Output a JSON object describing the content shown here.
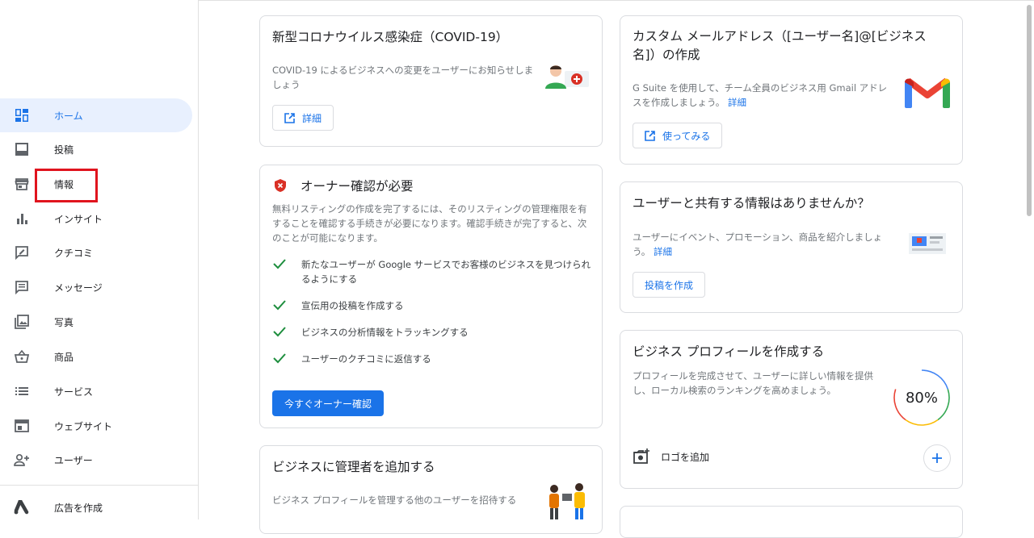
{
  "sidebar": {
    "items": [
      {
        "label": "ホーム",
        "icon": "dashboard-icon"
      },
      {
        "label": "投稿",
        "icon": "post-icon"
      },
      {
        "label": "情報",
        "icon": "store-icon"
      },
      {
        "label": "インサイト",
        "icon": "bar-chart-icon"
      },
      {
        "label": "クチコミ",
        "icon": "review-icon"
      },
      {
        "label": "メッセージ",
        "icon": "message-icon"
      },
      {
        "label": "写真",
        "icon": "photo-icon"
      },
      {
        "label": "商品",
        "icon": "basket-icon"
      },
      {
        "label": "サービス",
        "icon": "list-icon"
      },
      {
        "label": "ウェブサイト",
        "icon": "website-icon"
      },
      {
        "label": "ユーザー",
        "icon": "add-user-icon"
      }
    ],
    "ads": {
      "label": "広告を作成",
      "icon": "google-ads-icon"
    }
  },
  "covid": {
    "title": "新型コロナウイルス感染症（COVID-19）",
    "text": "COVID-19 によるビジネスへの変更をユーザーにお知らせしましょう",
    "button": "詳細"
  },
  "verify": {
    "title": "オーナー確認が必要",
    "text": "無料リスティングの作成を完了するには、そのリスティングの管理権限を有することを確認する手続きが必要になります。確認手続きが完了すると、次のことが可能になります。",
    "checks": [
      "新たなユーザーが Google サービスでお客様のビジネスを見つけられるようにする",
      "宣伝用の投稿を作成する",
      "ビジネスの分析情報をトラッキングする",
      "ユーザーのクチコミに返信する"
    ],
    "button": "今すぐオーナー確認"
  },
  "manager": {
    "title": "ビジネスに管理者を追加する",
    "text": "ビジネス プロフィールを管理する他のユーザーを招待する"
  },
  "email": {
    "title": "カスタム メールアドレス（[ユーザー名]@[ビジネス名]）の作成",
    "text": "G Suite を使用して、チーム全員のビジネス用 Gmail アドレスを作成しましょう。",
    "link": "詳細",
    "button": "使ってみる"
  },
  "share": {
    "title": "ユーザーと共有する情報はありませんか？",
    "text": "ユーザーにイベント、プロモーション、商品を紹介しましょう。",
    "link": "詳細",
    "button": "投稿を作成"
  },
  "profile": {
    "title": "ビジネス プロフィールを作成する",
    "text": "プロフィールを完成させて、ユーザーに詳しい情報を提供し、ローカル検索のランキングを高めましょう。",
    "progress": "80%",
    "progress_value": 0.8,
    "task": "ロゴを追加"
  },
  "colors": {
    "accent": "#1a73e8",
    "active_bg": "#e8f0fe",
    "check": "#1e8e3e",
    "alert": "#d93025",
    "highlight": "#e0141e"
  }
}
